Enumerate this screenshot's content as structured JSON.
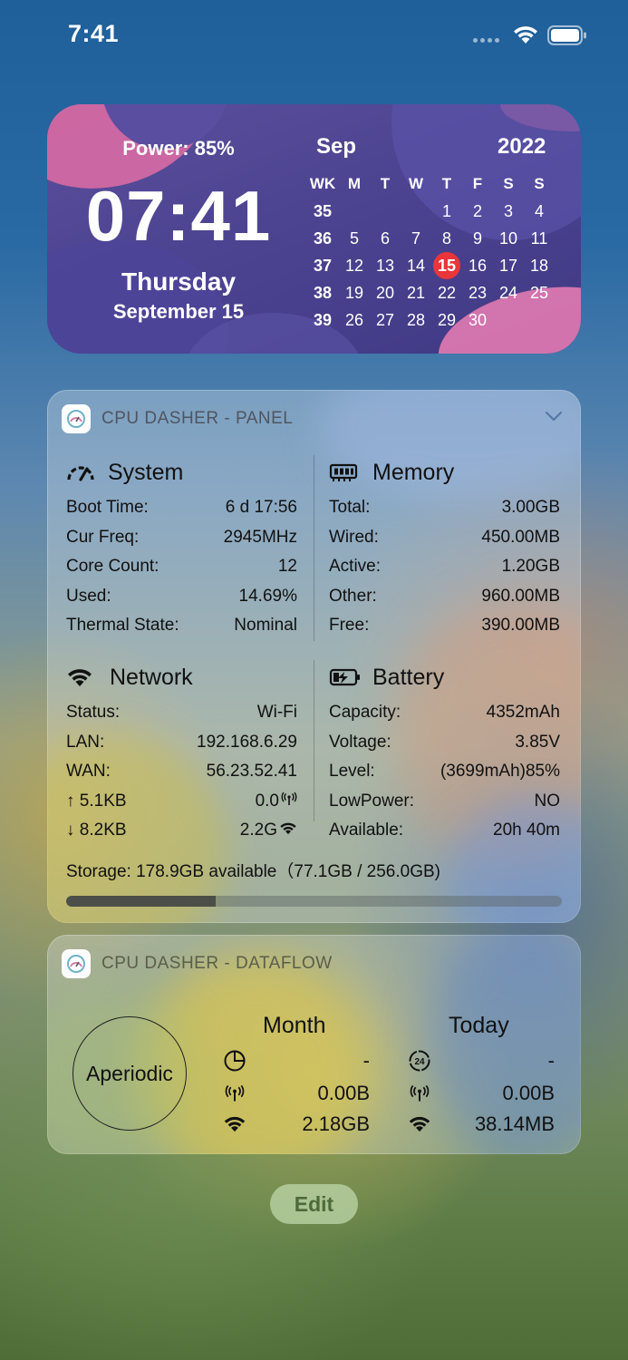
{
  "status_bar": {
    "time": "7:41"
  },
  "calendar_widget": {
    "power": "Power: 85%",
    "clock": "07:41",
    "weekday": "Thursday",
    "date": "September 15",
    "month": "Sep",
    "year": "2022",
    "headers": [
      "WK",
      "M",
      "T",
      "W",
      "T",
      "F",
      "S",
      "S"
    ],
    "weeks": [
      {
        "wk": "35",
        "days": [
          "",
          "",
          "",
          "1",
          "2",
          "3",
          "4"
        ]
      },
      {
        "wk": "36",
        "days": [
          "5",
          "6",
          "7",
          "8",
          "9",
          "10",
          "11"
        ]
      },
      {
        "wk": "37",
        "days": [
          "12",
          "13",
          "14",
          "15",
          "16",
          "17",
          "18"
        ]
      },
      {
        "wk": "38",
        "days": [
          "19",
          "20",
          "21",
          "22",
          "23",
          "24",
          "25"
        ]
      },
      {
        "wk": "39",
        "days": [
          "26",
          "27",
          "28",
          "29",
          "30",
          "",
          ""
        ]
      }
    ],
    "today": "15",
    "today_color": "#e8363a"
  },
  "panel": {
    "title": "CPU DASHER - PANEL",
    "system": {
      "title": "System",
      "icon": "gauge-icon",
      "rows": [
        {
          "label": "Boot Time:",
          "value": "6 d 17:56"
        },
        {
          "label": "Cur Freq:",
          "value": "2945MHz"
        },
        {
          "label": "Core Count:",
          "value": "12"
        },
        {
          "label": "Used:",
          "value": "14.69%"
        },
        {
          "label": "Thermal State:",
          "value": "Nominal"
        }
      ]
    },
    "memory": {
      "title": "Memory",
      "icon": "memory-chip-icon",
      "rows": [
        {
          "label": "Total:",
          "value": "3.00GB"
        },
        {
          "label": "Wired:",
          "value": "450.00MB"
        },
        {
          "label": "Active:",
          "value": "1.20GB"
        },
        {
          "label": "Other:",
          "value": "960.00MB"
        },
        {
          "label": "Free:",
          "value": "390.00MB"
        }
      ]
    },
    "network": {
      "title": "Network",
      "icon": "wifi-icon",
      "rows": [
        {
          "label": "Status:",
          "value": "Wi-Fi"
        },
        {
          "label": "LAN:",
          "value": "192.168.6.29"
        },
        {
          "label": "WAN:",
          "value": "56.23.52.41"
        }
      ],
      "upload": "5.1KB",
      "upload_cell": "0.0",
      "download": "8.2KB",
      "download_wifi": "2.2G"
    },
    "battery": {
      "title": "Battery",
      "icon": "battery-charging-icon",
      "rows": [
        {
          "label": "Capacity:",
          "value": "4352mAh"
        },
        {
          "label": "Voltage:",
          "value": "3.85V"
        },
        {
          "label": "Level:",
          "value": "(3699mAh)85%"
        },
        {
          "label": "LowPower:",
          "value": "NO"
        },
        {
          "label": "Available:",
          "value": "20h 40m"
        }
      ]
    },
    "storage": {
      "text": "Storage: 178.9GB available（77.1GB / 256.0GB)",
      "used_fraction": 0.301
    }
  },
  "dataflow": {
    "title": "CPU DASHER - DATAFLOW",
    "mode": "Aperiodic",
    "month_label": "Month",
    "today_label": "Today",
    "month": {
      "period": "-",
      "cellular": "0.00B",
      "wifi": "2.18GB"
    },
    "today": {
      "period": "-",
      "cellular": "0.00B",
      "wifi": "38.14MB"
    }
  },
  "edit_label": "Edit"
}
